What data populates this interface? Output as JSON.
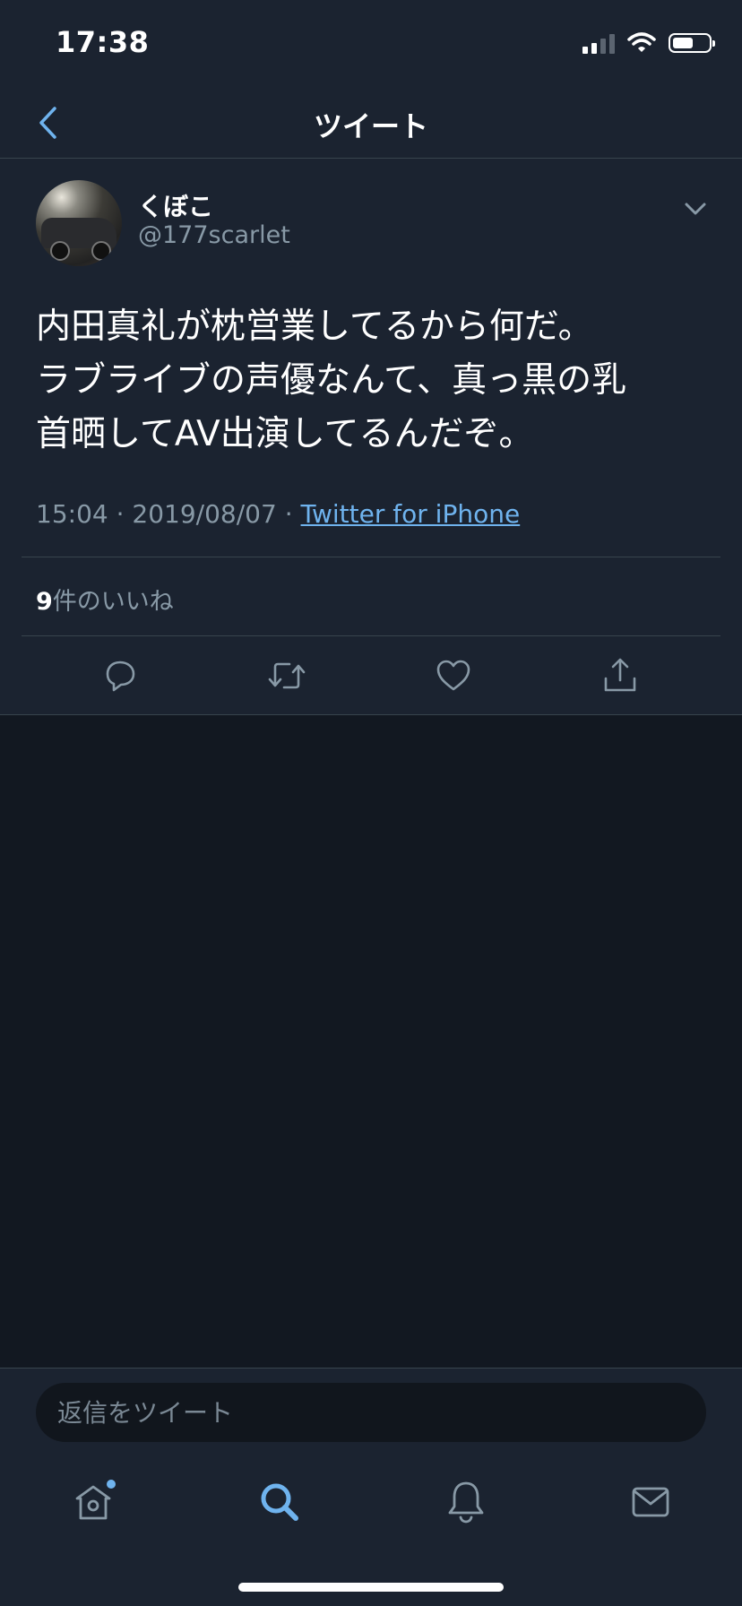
{
  "status_bar": {
    "time": "17:38"
  },
  "nav": {
    "title": "ツイート"
  },
  "tweet": {
    "display_name": "くぼこ",
    "handle": "@177scarlet",
    "text_lines": [
      "内田真礼が枕営業してるから何だ。",
      "ラブライブの声優なんて、真っ黒の乳",
      "首晒してAV出演してるんだぞ。"
    ],
    "time": "15:04",
    "date": "2019/08/07",
    "separator": "·",
    "source": "Twitter for iPhone",
    "likes_count": "9",
    "likes_label": "件のいいね"
  },
  "reply": {
    "placeholder": "返信をツイート"
  },
  "colors": {
    "accent": "#6fb3ee",
    "background": "#141a23",
    "secondary_text": "#8899a6"
  },
  "icons": {
    "actions": [
      "reply-icon",
      "retweet-icon",
      "like-icon",
      "share-icon"
    ],
    "tabs": [
      "home-icon",
      "search-icon",
      "notifications-icon",
      "messages-icon"
    ]
  }
}
